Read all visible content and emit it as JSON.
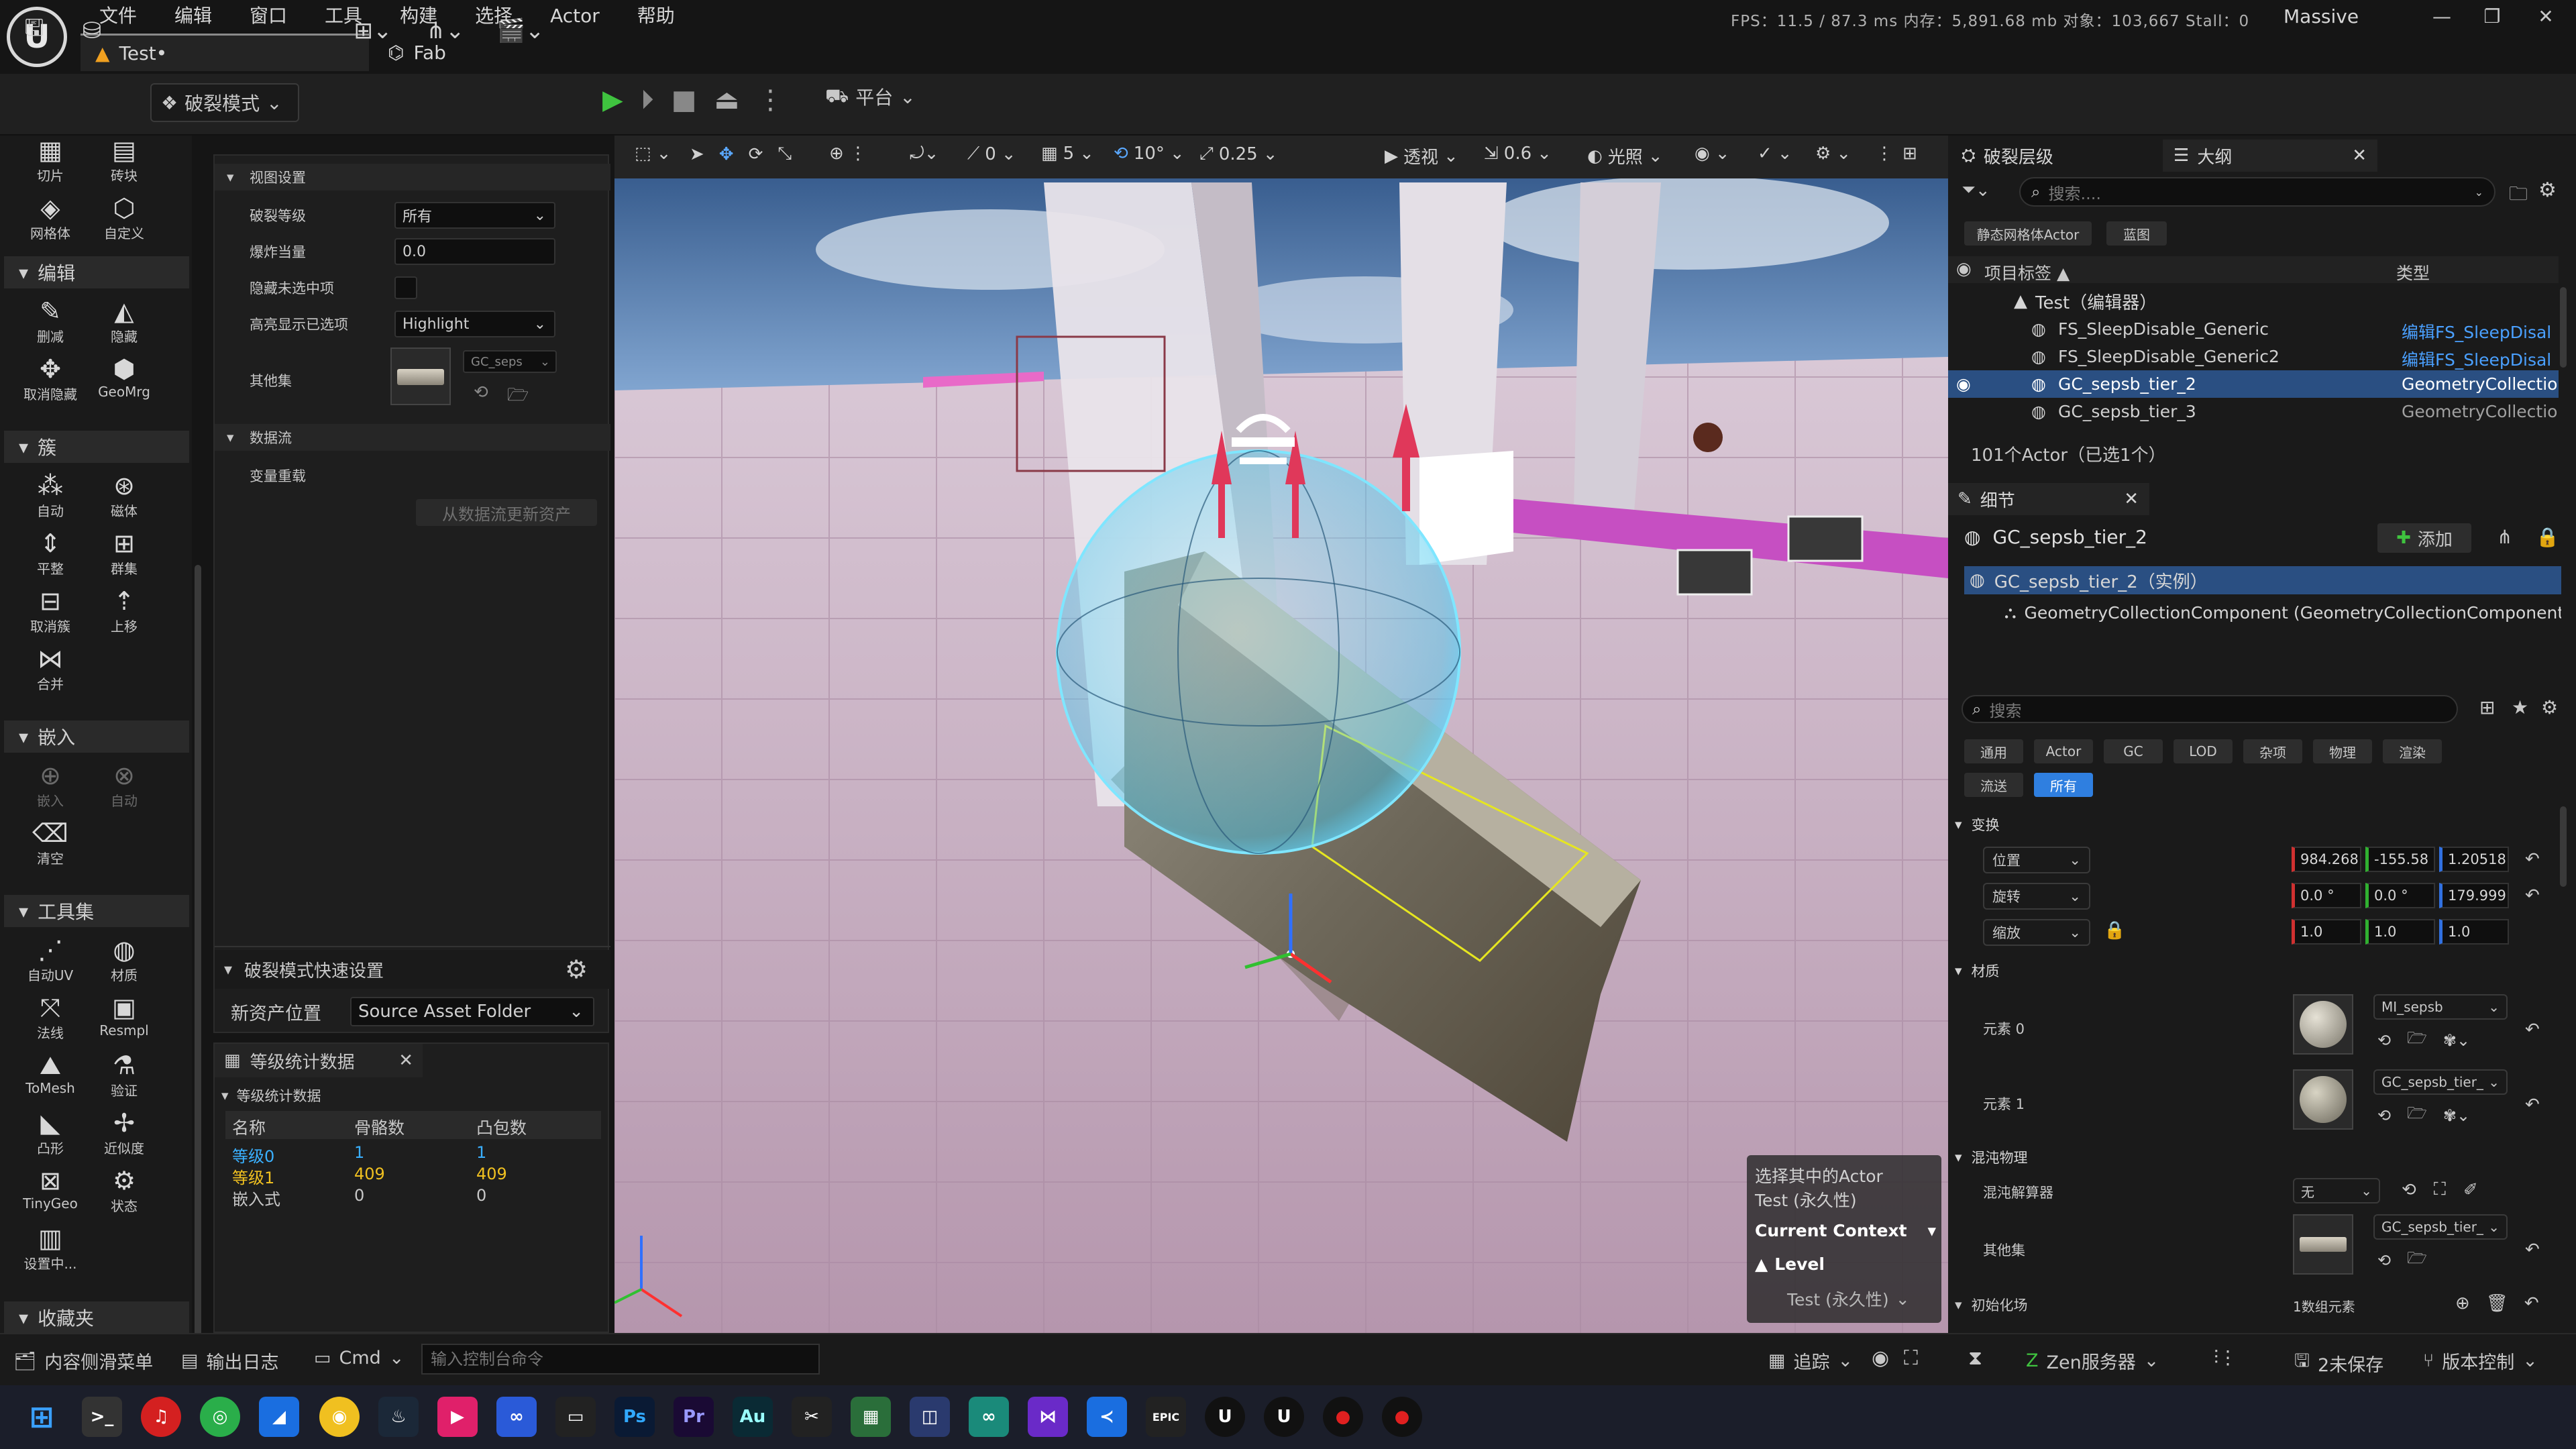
{
  "menu": [
    "文件",
    "编辑",
    "窗口",
    "工具",
    "构建",
    "选择",
    "Actor",
    "帮助"
  ],
  "tabs": {
    "test": "Test•",
    "fab": "Fab"
  },
  "stats": "FPS：11.5 / 87.3 ms   内存：5,891.68 mb  对象：103,667  Stall：0",
  "project": "Massive",
  "toolbar": {
    "mode": "破裂模式",
    "platform": "平台"
  },
  "lefttools": {
    "top": [
      {
        "g": "▦",
        "t": "切片"
      },
      {
        "g": "▤",
        "t": "砖块"
      },
      {
        "g": "◈",
        "t": "网格体"
      },
      {
        "g": "⬡",
        "t": "自定义"
      }
    ],
    "edit_title": "编辑",
    "edit": [
      {
        "g": "✎",
        "t": "删减"
      },
      {
        "g": "◭",
        "t": "隐藏"
      },
      {
        "g": "✥",
        "t": "取消隐藏"
      },
      {
        "g": "⬢",
        "t": "GeoMrg"
      }
    ],
    "cluster_title": "簇",
    "cluster": [
      {
        "g": "⁂",
        "t": "自动"
      },
      {
        "g": "⊛",
        "t": "磁体"
      },
      {
        "g": "⇕",
        "t": "平整"
      },
      {
        "g": "⊞",
        "t": "群集"
      },
      {
        "g": "⊟",
        "t": "取消簇"
      },
      {
        "g": "⇡",
        "t": "上移"
      },
      {
        "g": "⋈",
        "t": "合并"
      }
    ],
    "embed_title": "嵌入",
    "embed": [
      {
        "g": "⊕",
        "t": "嵌入"
      },
      {
        "g": "⊗",
        "t": "自动"
      },
      {
        "g": "⌫",
        "t": "清空"
      }
    ],
    "toolset_title": "工具集",
    "toolset": [
      {
        "g": "⋰",
        "t": "自动UV"
      },
      {
        "g": "◍",
        "t": "材质"
      },
      {
        "g": "⤧",
        "t": "法线"
      },
      {
        "g": "▣",
        "t": "Resmpl"
      },
      {
        "g": "⛰",
        "t": "ToMesh"
      },
      {
        "g": "⚗",
        "t": "验证"
      },
      {
        "g": "◣",
        "t": "凸形"
      },
      {
        "g": "✢",
        "t": "近似度"
      },
      {
        "g": "⊠",
        "t": "TinyGeo"
      },
      {
        "g": "⚙",
        "t": "状态"
      },
      {
        "g": "▥",
        "t": "设置中..."
      }
    ],
    "fav_title": "收藏夹"
  },
  "settings": {
    "view_title": "视图设置",
    "level_label": "破裂等级",
    "level_value": "所有",
    "explode_label": "爆炸当量",
    "explode_value": "0.0",
    "hide_label": "隐藏未选中项",
    "highlight_label": "高亮显示已选项",
    "highlight_value": "Highlight",
    "other_label": "其他集",
    "other_value": "GC_seps",
    "dataflow_title": "数据流",
    "var_label": "变量重载",
    "update_btn": "从数据流更新资产",
    "quick_title": "破裂模式快速设置",
    "newpos_label": "新资产位置",
    "newpos_value": "Source Asset Folder"
  },
  "levelstats": {
    "tab": "等级统计数据",
    "section": "等级统计数据",
    "headers": [
      "名称",
      "骨骼数",
      "凸包数"
    ],
    "rows": [
      [
        "等级0",
        "1",
        "1"
      ],
      [
        "等级1",
        "409",
        "409"
      ],
      [
        "嵌入式",
        "0",
        "0"
      ]
    ]
  },
  "viewport": {
    "values": [
      "0",
      "5",
      "10°",
      "0.25"
    ],
    "view": "透视",
    "speed": "0.6",
    "lighting": "光照",
    "context": {
      "sel": "选择其中的Actor",
      "test": "Test (永久性)",
      "ctx": "Current Context",
      "level": "Level",
      "persist": "Test (永久性)"
    }
  },
  "outliner": {
    "tab1": "破裂层级",
    "tab2": "大纲",
    "search": "搜索....",
    "filter1": "静态网格体Actor",
    "filter2": "蓝图",
    "col1": "项目标签 ▲",
    "col2": "类型",
    "root": "Test（编辑器）",
    "items": [
      {
        "name": "FS_SleepDisable_Generic",
        "type": "编辑FS_SleepDisal"
      },
      {
        "name": "FS_SleepDisable_Generic2",
        "type": "编辑FS_SleepDisal"
      },
      {
        "name": "GC_sepsb_tier_2",
        "type": "GeometryCollection"
      },
      {
        "name": "GC_sepsb_tier_3",
        "type": "GeometryCollection"
      }
    ],
    "count": "101个Actor（已选1个）"
  },
  "details": {
    "tab": "细节",
    "object": "GC_sepsb_tier_2",
    "add": "添加",
    "instance": "GC_sepsb_tier_2（实例）",
    "component": "GeometryCollectionComponent (GeometryCollectionComponent0)",
    "search": "搜索",
    "cats": [
      "通用",
      "Actor",
      "GC",
      "LOD",
      "杂项",
      "物理",
      "渲染",
      "流送",
      "所有"
    ],
    "transform_title": "变换",
    "loc_label": "位置",
    "loc": [
      "984.268",
      "-155.58",
      "1.20518"
    ],
    "rot_label": "旋转",
    "rot": [
      "0.0 °",
      "0.0 °",
      "179.999"
    ],
    "scale_label": "缩放",
    "scale": [
      "1.0",
      "1.0",
      "1.0"
    ],
    "material_title": "材质",
    "elem0": "元素 0",
    "mat0": "MI_sepsb",
    "elem1": "元素 1",
    "mat1": "GC_sepsb_tier_",
    "chaos_title": "混沌物理",
    "solver_label": "混沌解算器",
    "solver_value": "无",
    "other_label": "其他集",
    "other_value": "GC_sepsb_tier_",
    "init_label": "初始化场",
    "init_value": "1数组元素"
  },
  "status": {
    "drawer": "内容侧滑菜单",
    "log": "输出日志",
    "cmd": "Cmd",
    "cmd_placeholder": "输入控制台命令",
    "trace": "追踪",
    "zen": "Zen服务器",
    "unsaved": "2未保存",
    "vc": "版本控制"
  },
  "colors": {
    "accent": "#2f7fe0",
    "play": "#3fc33f",
    "selection": "#2a4f82"
  }
}
